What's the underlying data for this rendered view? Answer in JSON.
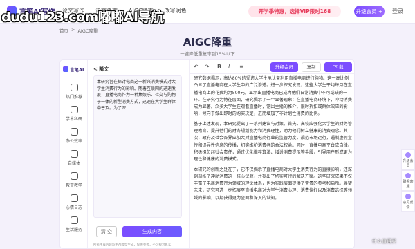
{
  "watermark": "dudu123.com嘟嘟AI导航",
  "nav": {
    "brand": "言笔AI写作",
    "links": [
      "论文写作",
      "论文降重",
      "AIGC降重",
      "改写润色"
    ],
    "promo": "开学季特惠，选择VIP限时168",
    "member_label": "升级会员 +",
    "login_label": "登录"
  },
  "breadcrumb": {
    "home": "首页",
    "sep": ">",
    "current": "AIGC降重"
  },
  "hero": {
    "title": "AIGC降重",
    "subtitle": "一键降低重复率到15%以下"
  },
  "sidebar": {
    "brand": "言笔AI",
    "items": [
      "热门推荐",
      "学术科研",
      "办公效率",
      "自媒体",
      "教育教学",
      "心情日志",
      "生活服务"
    ]
  },
  "input": {
    "title": "< 降文",
    "text": "本研究旨在探讨电商这一新兴消费模式对大学生消费行为的影响。随着互联网的迅速发展，直播电商作为一种集娱乐、社交与购物于一体的新型消费方式，迅速在大学生群体中普及。为了深",
    "clear_label": "清 空",
    "generate_label": "生成内容",
    "note": "所有生成内容均由AI模型生成，仅供参考，不可视为真实"
  },
  "toolbar": {
    "undo": "↶",
    "redo": "↷",
    "bold": "B",
    "italic": "I",
    "align": "≡",
    "upgrade_label": "升级会员",
    "copy_label": "复制",
    "download_label": "下 载"
  },
  "output": {
    "paragraphs": [
      "研究数据揭示，高达80%的受访大学生承认曾利用直播电商进行购物。这一高比例凸显了直播电商在大学生中的广泛渗透。进一步探究发现，这些大学生平均每月在直播电商上的花费约为500元。显示出直播电商已成为他们日常消费中不可或缺的一环。在研究行为特征层面，研究揭示了一个显著现象：在直播电商环境下，冲动消费成为显著。众多大学生在观看直播时，常因主播的推介、限时折扣或群体效应的影响，倾向于做出即时的购买决定，进而增加了非计划性消费的比例。",
      "基于上述发现，本研究提出了一系列建议与对策。首先，高校应强化大学生的财务管理教育，提升他们的财务规划能力和消费理性，助力他们树立健康的消费观念。其次，政府及社会各界应加大对直播电商行业的监管力度，规范市场运行，遏制虚假宣传和误导性信息的传播，切实维护消费者的合法权益。同时，直播电商平台应自律、积极担负起社会责任，通过优化推荐算法、增设消费提示等手段，引导用户形成更为理性和健康的消费模式。",
      "本研究的创新之处在于，它不仅揭示了直播电商对大学生消费行为的直接影响，还深刻剖析了冲动消费这一核心议题，并提出了切实可行的解决方案。这些研究成果不仅丰富了电商消费行为领域的理论体系，也为实践层面提供了宝贵的参考和启示。展望未来，研究可进一步拓展至直播电商对大学生消费心理、消费偏好以及消费选择等领域的影响，以期获得更为全面和深入的认知。"
    ]
  },
  "floatbar": [
    "升级会员",
    "联系客服",
    "意见反馈"
  ],
  "credit": "什么值得买"
}
